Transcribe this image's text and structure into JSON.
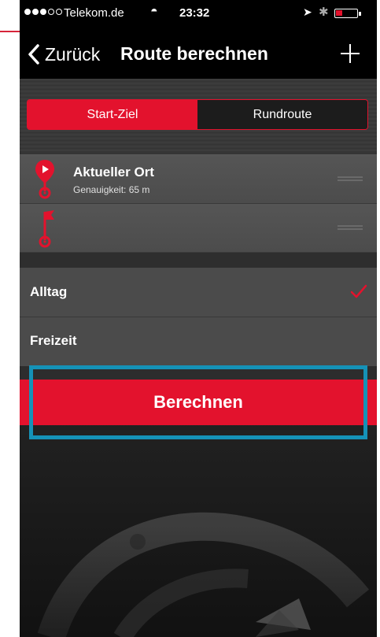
{
  "status_bar": {
    "carrier": "Telekom.de",
    "time": "23:32",
    "signal_dots_filled": 3,
    "signal_dots_total": 5,
    "battery_level": 0.25
  },
  "nav": {
    "back_label": "Zurück",
    "title": "Route berechnen",
    "add_icon": "plus-icon"
  },
  "segments": {
    "options": [
      "Start-Ziel",
      "Rundroute"
    ],
    "selected": "Start-Ziel"
  },
  "stops": [
    {
      "name": "Aktueller Ort",
      "detail": "Genauigkeit: 65 m",
      "icon": "start-pin-icon"
    },
    {
      "name": "",
      "detail": "",
      "icon": "destination-flag-icon"
    }
  ],
  "profiles": [
    {
      "label": "Alltag",
      "checked": true
    },
    {
      "label": "Freizeit",
      "checked": false
    }
  ],
  "calculate_label": "Berechnen",
  "colors": {
    "accent": "#e3122d",
    "highlight_frame": "#1592b7"
  }
}
